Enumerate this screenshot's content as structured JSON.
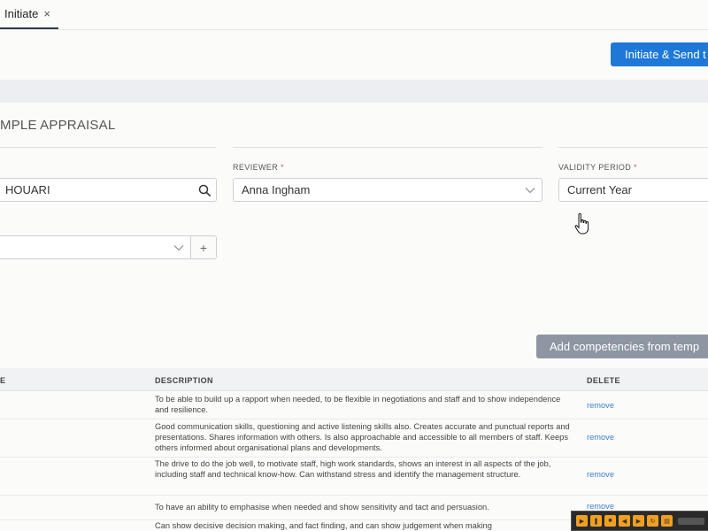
{
  "tab": {
    "label": "Initiate",
    "close": "×"
  },
  "header": {
    "primary_button": "Initiate & Send t"
  },
  "section": {
    "title": "MPLE APPRAISAL"
  },
  "fields": {
    "employee": {
      "value": "HOUARI"
    },
    "reviewer": {
      "label": "REVIEWER",
      "required": "*",
      "value": "Anna Ingham"
    },
    "validity": {
      "label": "VALIDITY PERIOD",
      "required": "*",
      "value": "Current Year"
    },
    "extra": {
      "value": "",
      "add": "+"
    }
  },
  "competencies_button": "Add competencies from temp",
  "table": {
    "headers": {
      "name": "E",
      "description": "DESCRIPTION",
      "delete": "DELETE"
    },
    "rows": [
      {
        "description": "To be able to build up a rapport when needed, to be flexible in negotiations and staff and to show independence and resilience.",
        "action": "remove"
      },
      {
        "description": "Good communication skills, questioning and active listening skills also. Creates accurate and punctual reports and presentations. Shares information with others. Is also approachable and accessible to all members of staff. Keeps others informed about organisational plans and developments.",
        "action": "remove"
      },
      {
        "description": "The drive to do the job well, to motivate staff, high work standards, shows an interest in all aspects of the job, including staff and technical know-how. Can withstand stress and identify the management structure.",
        "action": "remove"
      },
      {
        "description": "To have an ability to emphasise when needed and show sensitivity and tact and persuasion.",
        "action": "remove"
      },
      {
        "description": "Can show decisive decision making, and fact finding, and can show judgement when making",
        "action": ""
      }
    ]
  },
  "colors": {
    "primary": "#1e78d8",
    "secondary": "#8d96a2",
    "link": "#3f7fc9"
  }
}
